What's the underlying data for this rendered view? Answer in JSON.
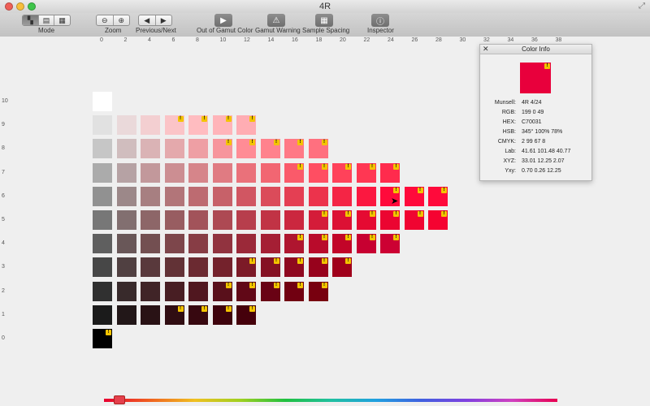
{
  "window": {
    "title": "4R"
  },
  "toolbar": {
    "mode_label": "Mode",
    "zoom_label": "Zoom",
    "prevnext_label": "Previous/Next",
    "gamut_color_label": "Out of Gamut Color",
    "gamut_warning_label": "Gamut Warning",
    "spacing_label": "Sample Spacing",
    "inspector_label": "Inspector",
    "icons": [
      "mode-hue-icon",
      "mode-value-icon",
      "mode-chroma-icon",
      "zoom-out-icon",
      "zoom-in-icon",
      "previous-icon",
      "next-icon",
      "out-of-gamut-icon",
      "gamut-warning-icon",
      "sample-spacing-icon",
      "inspector-icon"
    ]
  },
  "ruler": {
    "chroma_ticks": [
      "0",
      "2",
      "4",
      "6",
      "8",
      "10",
      "12",
      "14",
      "16",
      "18",
      "20",
      "22",
      "24",
      "26",
      "28",
      "30",
      "32",
      "34",
      "36",
      "38"
    ],
    "value_ticks": [
      "10",
      "9",
      "8",
      "7",
      "6",
      "5",
      "4",
      "3",
      "2",
      "1",
      "0"
    ]
  },
  "chart": {
    "value_rows": [
      {
        "value": 10,
        "chromas": [
          0
        ],
        "colors": [
          "#ffffff"
        ],
        "warnings": []
      },
      {
        "value": 9,
        "chromas": [
          0,
          2,
          4,
          6,
          8,
          10,
          12
        ],
        "colors": [
          "#e1e1e1",
          "#ead9da",
          "#f3cfd1",
          "#fbc4c7",
          "#ffbcc0",
          "#ffb4b9",
          "#ffadb3"
        ],
        "warnings": [
          6,
          8,
          10,
          12
        ]
      },
      {
        "value": 8,
        "chromas": [
          0,
          2,
          4,
          6,
          8,
          10,
          12,
          14,
          16,
          18
        ],
        "colors": [
          "#c6c6c6",
          "#d0bdbe",
          "#dab3b5",
          "#e4a9ac",
          "#ee9fa4",
          "#f7959c",
          "#ff8c95",
          "#ff828d",
          "#ff7986",
          "#ff707f"
        ],
        "warnings": [
          10,
          12,
          14,
          16,
          18
        ]
      },
      {
        "value": 7,
        "chromas": [
          0,
          2,
          4,
          6,
          8,
          10,
          12,
          14,
          16,
          18,
          20,
          22,
          24
        ],
        "colors": [
          "#ababab",
          "#b6a2a4",
          "#c2989b",
          "#cc8e92",
          "#d6858a",
          "#e07b82",
          "#ea717a",
          "#f26672",
          "#fa5a6a",
          "#ff4e62",
          "#ff425a",
          "#ff3753",
          "#ff2b4d"
        ],
        "warnings": [
          16,
          18,
          20,
          22,
          24
        ]
      },
      {
        "value": 6,
        "chromas": [
          0,
          2,
          4,
          6,
          8,
          10,
          12,
          14,
          16,
          18,
          20,
          22,
          24,
          26,
          28
        ],
        "colors": [
          "#919191",
          "#9c8889",
          "#a77f81",
          "#b27579",
          "#bd6b71",
          "#c76169",
          "#d15662",
          "#db4b5a",
          "#e43f53",
          "#ec334c",
          "#f42545",
          "#fb1840",
          "#ff0a3b",
          "#ff0a3b",
          "#ff0a3b"
        ],
        "warnings": [
          24,
          26,
          28
        ]
      },
      {
        "value": 5,
        "chromas": [
          0,
          2,
          4,
          6,
          8,
          10,
          12,
          14,
          16,
          18,
          20,
          22,
          24,
          26,
          28
        ],
        "colors": [
          "#777777",
          "#826f70",
          "#8d6668",
          "#985d61",
          "#a2535a",
          "#ad4953",
          "#b73e4c",
          "#c13345",
          "#cb273f",
          "#d41c39",
          "#dc1134",
          "#e50a32",
          "#eb0531",
          "#f00431",
          "#f50331"
        ],
        "warnings": [
          18,
          20,
          22,
          24,
          26,
          28
        ]
      },
      {
        "value": 4,
        "chromas": [
          0,
          2,
          4,
          6,
          8,
          10,
          12,
          14,
          16,
          18,
          20,
          22,
          24
        ],
        "colors": [
          "#5f5f5f",
          "#695758",
          "#734f51",
          "#7d464b",
          "#873d45",
          "#91333f",
          "#9b2939",
          "#a51f34",
          "#af152f",
          "#b90b2b",
          "#c20528",
          "#c70031",
          "#cc0133"
        ],
        "warnings": [
          16,
          18,
          20,
          22,
          24
        ]
      },
      {
        "value": 3,
        "chromas": [
          0,
          2,
          4,
          6,
          8,
          10,
          12,
          14,
          16,
          18,
          20
        ],
        "colors": [
          "#474747",
          "#504041",
          "#59393c",
          "#623236",
          "#6b2a31",
          "#74222c",
          "#7c1a27",
          "#851123",
          "#8e081f",
          "#97021c",
          "#a0001b"
        ],
        "warnings": [
          12,
          14,
          16,
          18,
          20
        ]
      },
      {
        "value": 2,
        "chromas": [
          0,
          2,
          4,
          6,
          8,
          10,
          12,
          14,
          16,
          18
        ],
        "colors": [
          "#303030",
          "#382a2b",
          "#402427",
          "#481e23",
          "#50171f",
          "#59101b",
          "#610817",
          "#690214",
          "#710011",
          "#78000f"
        ],
        "warnings": [
          10,
          12,
          14,
          16,
          18
        ]
      },
      {
        "value": 1,
        "chromas": [
          0,
          2,
          4,
          6,
          8,
          10,
          12
        ],
        "colors": [
          "#1b1b1b",
          "#221718",
          "#291215",
          "#300d12",
          "#370810",
          "#3e030d",
          "#45000b"
        ],
        "warnings": [
          6,
          8,
          10,
          12
        ]
      },
      {
        "value": 0,
        "chromas": [
          0
        ],
        "colors": [
          "#000000"
        ],
        "warnings": [
          0
        ]
      }
    ]
  },
  "inspector": {
    "title": "Color Info",
    "swatch_color": "#e8003c",
    "swatch_warning": true,
    "rows": [
      {
        "key": "Munsell:",
        "val": "4R 4/24"
      },
      {
        "key": "RGB:",
        "val": "199 0 49"
      },
      {
        "key": "HEX:",
        "val": "C70031"
      },
      {
        "key": "HSB:",
        "val": "345° 100% 78%"
      },
      {
        "key": "CMYK:",
        "val": "2 99 67 8"
      },
      {
        "key": "Lab:",
        "val": "41.61 101.48 40.77"
      },
      {
        "key": "XYZ:",
        "val": "33.01 12.25 2.07"
      },
      {
        "key": "Yxy:",
        "val": "0.70 0.26 12.25"
      }
    ]
  },
  "hue_slider": {
    "value_label": "4R"
  }
}
